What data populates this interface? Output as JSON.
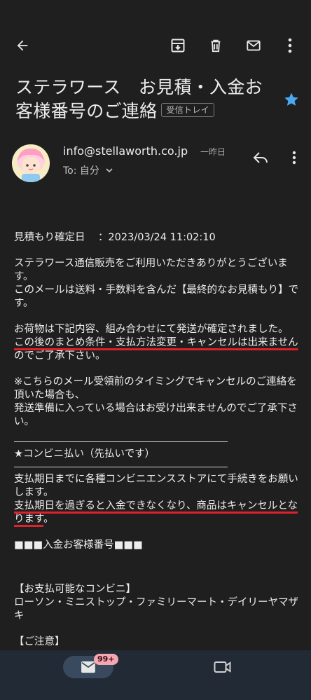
{
  "toolbar": {
    "back_icon": "arrow-left-icon",
    "archive_icon": "archive-icon",
    "delete_icon": "trash-icon",
    "mark_unread_icon": "mail-icon",
    "more_icon": "more-vert-icon"
  },
  "email": {
    "subject": "ステラワース　お見積・入金お客様番号のご連絡",
    "label": "受信トレイ",
    "starred": true,
    "sender": "info@stellaworth.co.jp",
    "time": "一昨日",
    "to": "To: 自分",
    "body": {
      "confirm_date_label": "見積もり確定日",
      "confirm_date_value": "：2023/03/24 11:02:10",
      "p1_line1": "ステラワース通信販売をご利用いただきありがとうございます。",
      "p1_line2": "このメールは送料・手数料を含んだ【最終的なお見積もり】です。",
      "p2_line1": "お荷物は下記内容、組み合わせにて発送が確定されました。",
      "p2_line2a": "この後のまとめ条件・支払方法変更・",
      "p2_line2b": "キャンセルは出来ません",
      "p2_line2c": "のでご了承下さい。",
      "p3_line1": "※こちらのメール受領前のタイミングでキャンセルのご連絡を頂いた場合も、",
      "p3_line2": "発送準備に入っている場合はお受け出来ませんのでご了承下さい。",
      "section_title": "★コンビニ払い（先払いです）",
      "p4_line1": "支払期日までに各種コンビニエンスストアにて手続きをお願いします。",
      "p4_line2a": "支払期日を過ぎると入金できなくなり、",
      "p4_line2b": "商品はキャンセルとなります",
      "p4_line2c": "。",
      "number_heading": "■■■入金お客様番号■■■",
      "conv_title": "【お支払可能なコンビニ】",
      "conv_list": "ローソン・ミニストップ・ファミリーマート・デイリーヤマザキ",
      "notice_title": "【ご注意】"
    }
  },
  "bottom_nav": {
    "mail_icon": "mail-icon",
    "badge": "99+",
    "meet_icon": "video-camera-icon"
  },
  "colors": {
    "background": "#1f1f1f",
    "star": "#4aa8f0",
    "underline": "#e0202a",
    "nav_bg": "#222a35",
    "badge_bg": "#f4a6b1"
  }
}
